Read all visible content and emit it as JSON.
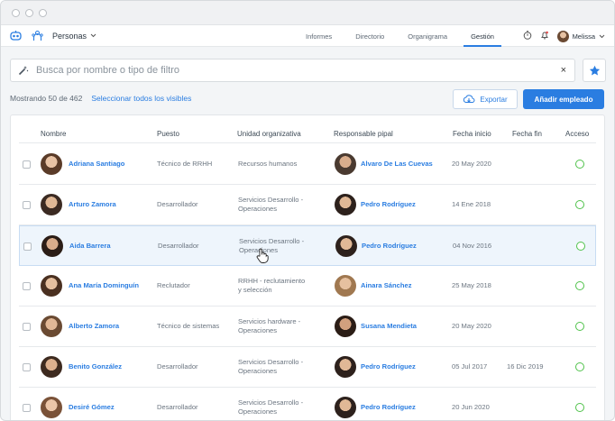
{
  "nav": {
    "section_label": "Personas",
    "tabs": [
      "Informes",
      "Directorio",
      "Organigrama",
      "Gestión"
    ],
    "active_tab": "Gestión",
    "user_name": "Melissa"
  },
  "search": {
    "placeholder": "Busca por nombre o tipo de filtro",
    "clear": "×"
  },
  "summary": {
    "showing": "Mostrando 50 de 462",
    "select_all": "Seleccionar todos los visibles"
  },
  "buttons": {
    "export": "Exportar",
    "add": "Añadir empleado"
  },
  "table": {
    "headers": {
      "name": "Nombre",
      "position": "Puesto",
      "unit": "Unidad organizativa",
      "manager": "Responsable pipal",
      "start": "Fecha inicio",
      "end": "Fecha fin",
      "access": "Acceso"
    },
    "rows": [
      {
        "name": "Adriana Santiago",
        "position": "Técnico de RRHH",
        "unit1": "Recursos humanos",
        "unit2": "",
        "manager": "Alvaro De Las Cuevas",
        "start": "20 May 2020",
        "end": ""
      },
      {
        "name": "Arturo Zamora",
        "position": "Desarrollador",
        "unit1": "Servicios Desarrollo -",
        "unit2": "Operaciones",
        "manager": "Pedro Rodríguez",
        "start": "14 Ene 2018",
        "end": ""
      },
      {
        "name": "Aida Barrera",
        "position": "Desarrollador",
        "unit1": "Servicios Desarrollo -",
        "unit2": "Operaciones",
        "manager": "Pedro Rodríguez",
        "start": "04 Nov 2016",
        "end": ""
      },
      {
        "name": "Ana María Dominguín",
        "position": "Reclutador",
        "unit1": "RRHH - reclutamiento",
        "unit2": "y selección",
        "manager": "Ainara Sánchez",
        "start": "25 May 2018",
        "end": ""
      },
      {
        "name": "Alberto Zamora",
        "position": "Técnico de sistemas",
        "unit1": "Servicios hardware -",
        "unit2": "Operaciones",
        "manager": "Susana Mendieta",
        "start": "20 May 2020",
        "end": ""
      },
      {
        "name": "Benito González",
        "position": "Desarrollador",
        "unit1": "Servicios Desarrollo -",
        "unit2": "Operaciones",
        "manager": "Pedro Rodríguez",
        "start": "05 Jul 2017",
        "end": "16 Dic 2019"
      },
      {
        "name": "Desiré Gómez",
        "position": "Desarrollador",
        "unit1": "Servicios Desarrollo -",
        "unit2": "Operaciones",
        "manager": "Pedro Rodríguez",
        "start": "20 Jun 2020",
        "end": ""
      }
    ]
  },
  "colors": {
    "accent": "#2a7de1",
    "status_active": "#4fc24a"
  }
}
